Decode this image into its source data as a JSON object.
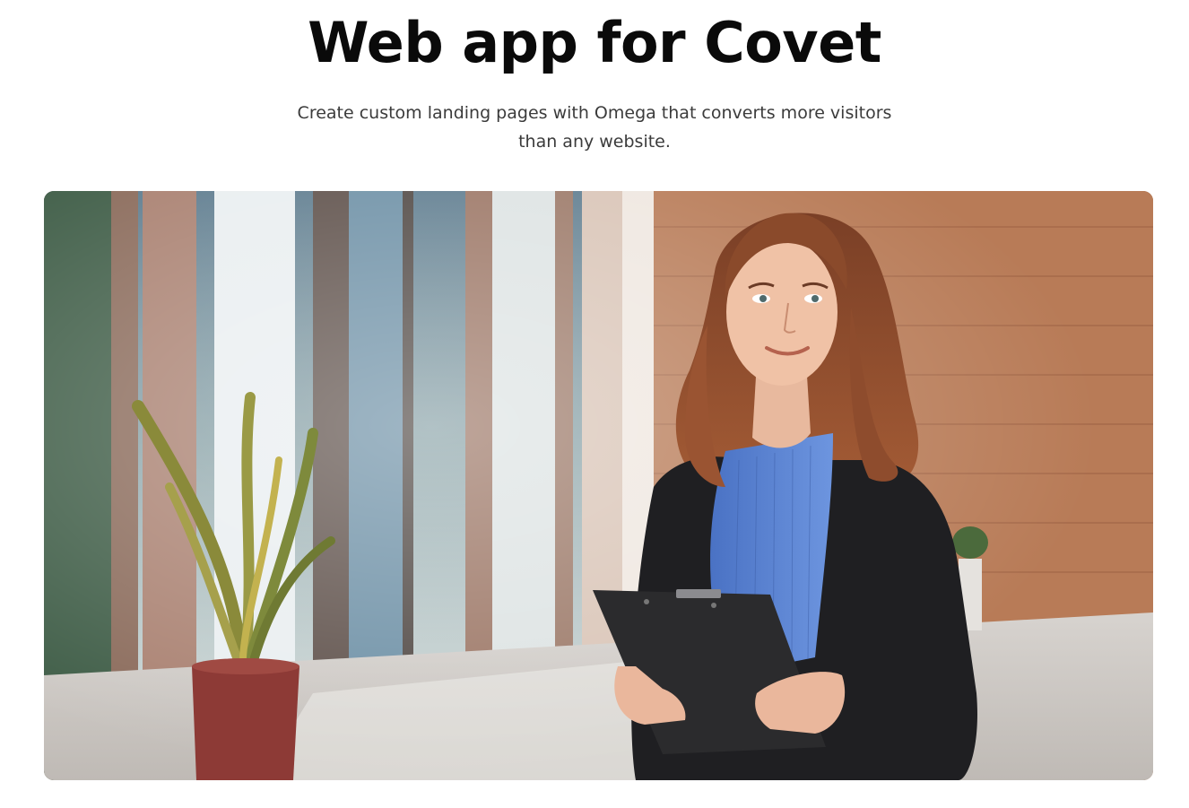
{
  "hero": {
    "title": "Web app for Covet",
    "subtitle_line1": "Create custom landing pages with Omega that converts more visitors",
    "subtitle_line2": "than any website."
  },
  "image": {
    "alt": "Smiling woman in a blue shirt and black blazer holding a clipboard in an office corridor"
  },
  "colors": {
    "title": "#0a0a0a",
    "subtitle": "#3b3b3b",
    "background": "#ffffff"
  }
}
